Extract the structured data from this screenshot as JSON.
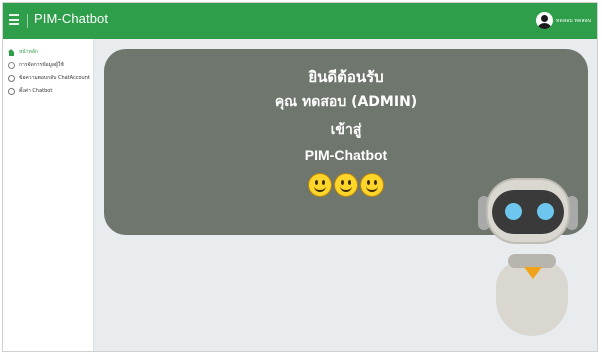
{
  "header": {
    "app_title": "PIM-Chatbot",
    "username": "ทดสอบ ทดสอบ"
  },
  "sidebar": {
    "items": [
      {
        "label": "หน้าหลัก",
        "icon": "home-icon",
        "active": true
      },
      {
        "label": "การจัดการข้อมูลผู้ใช้",
        "icon": "users-icon",
        "active": false
      },
      {
        "label": "ข้อความตอบกลับ ChatAccount",
        "icon": "circle-icon",
        "active": false
      },
      {
        "label": "ตั้งค่า Chatbot",
        "icon": "circle-icon",
        "active": false
      }
    ]
  },
  "welcome": {
    "line1": "ยินดีต้อนรับ",
    "line2": "คุณ ทดสอบ (ADMIN)",
    "line3": "เข้าสู่",
    "line4": "PIM-Chatbot"
  },
  "colors": {
    "topbar": "#2e9e4a",
    "card": "#6f766d",
    "background": "#e9ecef"
  }
}
